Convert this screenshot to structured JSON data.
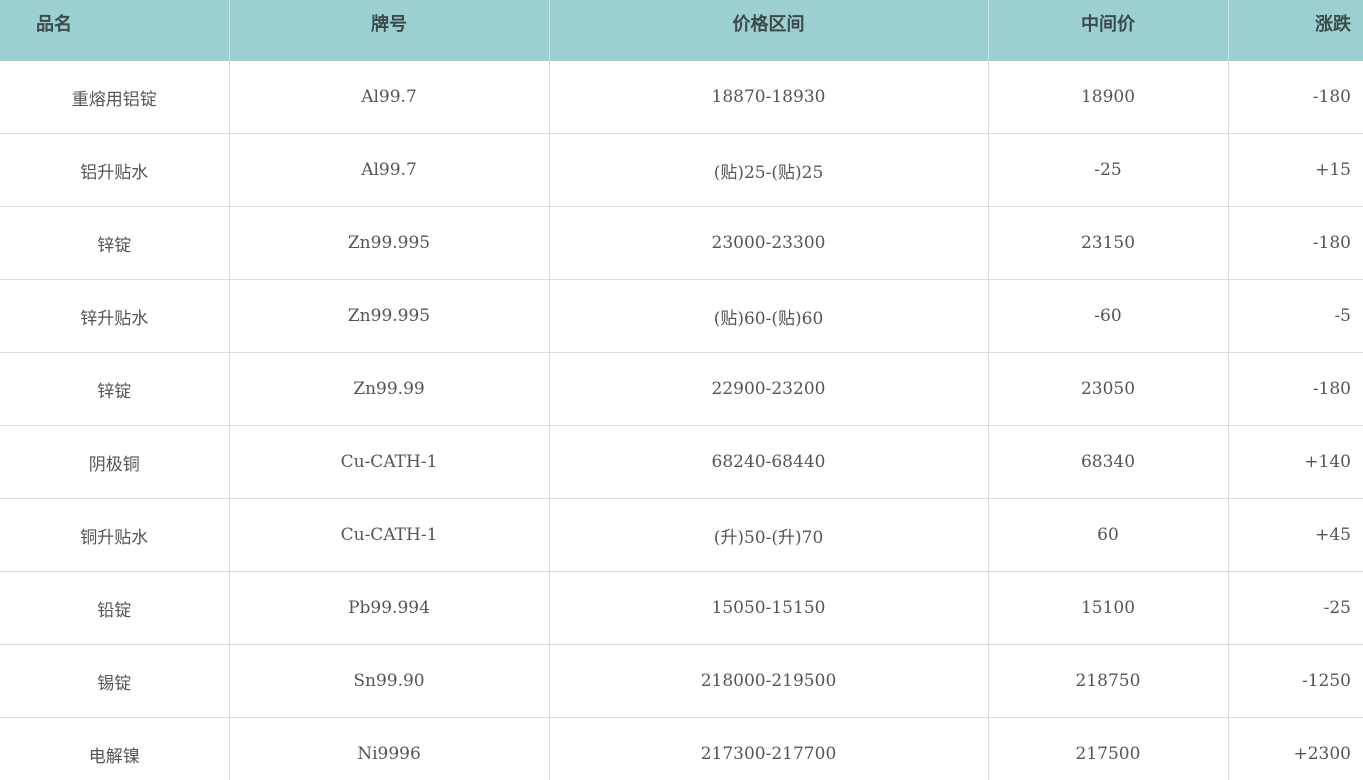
{
  "table": {
    "headers": {
      "name": "品名",
      "grade": "牌号",
      "range": "价格区间",
      "mid": "中间价",
      "change": "涨跌"
    },
    "rows": [
      {
        "name": "重熔用铝锭",
        "grade": "Al99.7",
        "range": "18870-18930",
        "mid": "18900",
        "change": "-180"
      },
      {
        "name": "铝升贴水",
        "grade": "Al99.7",
        "range": "(贴)25-(贴)25",
        "mid": "-25",
        "change": "+15"
      },
      {
        "name": "锌锭",
        "grade": "Zn99.995",
        "range": "23000-23300",
        "mid": "23150",
        "change": "-180"
      },
      {
        "name": "锌升贴水",
        "grade": "Zn99.995",
        "range": "(贴)60-(贴)60",
        "mid": "-60",
        "change": "-5"
      },
      {
        "name": "锌锭",
        "grade": "Zn99.99",
        "range": "22900-23200",
        "mid": "23050",
        "change": "-180"
      },
      {
        "name": "阴极铜",
        "grade": "Cu-CATH-1",
        "range": "68240-68440",
        "mid": "68340",
        "change": "+140"
      },
      {
        "name": "铜升贴水",
        "grade": "Cu-CATH-1",
        "range": "(升)50-(升)70",
        "mid": "60",
        "change": "+45"
      },
      {
        "name": "铅锭",
        "grade": "Pb99.994",
        "range": "15050-15150",
        "mid": "15100",
        "change": "-25"
      },
      {
        "name": "锡锭",
        "grade": "Sn99.90",
        "range": "218000-219500",
        "mid": "218750",
        "change": "-1250"
      },
      {
        "name": "电解镍",
        "grade": "Ni9996",
        "range": "217300-217700",
        "mid": "217500",
        "change": "+2300"
      }
    ]
  },
  "colors": {
    "header_bg": "#9ccfcf",
    "header_text": "#3d4a4a",
    "cell_text": "#555555",
    "grid": "#dcdcdc"
  }
}
